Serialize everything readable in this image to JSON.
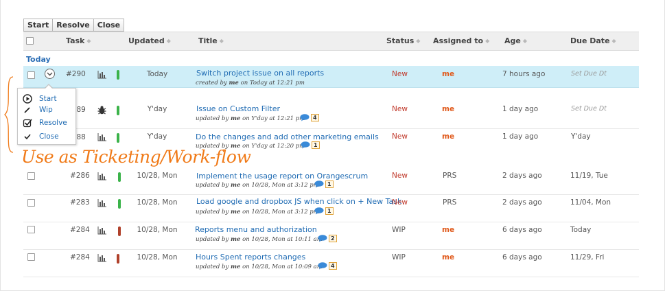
{
  "toolbar": {
    "start": "Start",
    "resolve": "Resolve",
    "close": "Close"
  },
  "columns": {
    "task": "Task",
    "updated": "Updated",
    "title": "Title",
    "status": "Status",
    "assigned": "Assigned to",
    "age": "Age",
    "due": "Due Date"
  },
  "group": "Today",
  "rows": [
    {
      "task": "#290",
      "updated": "Today",
      "title": "Switch project issue on all reports",
      "sub_a": "created by ",
      "sub_user": "me",
      "sub_b": " on Today at 12:21 pm",
      "status": "New",
      "assigned": "me",
      "age": "7 hours ago",
      "due": "Set Due Dt",
      "comments": ""
    },
    {
      "task": "#289",
      "updated": "Y'day",
      "title": "Issue on Custom Filter",
      "sub_a": "updated by ",
      "sub_user": "me",
      "sub_b": " on Y'day at 12:21 pm",
      "status": "New",
      "assigned": "me",
      "age": "1 day ago",
      "due": "Set Due Dt",
      "comments": "4"
    },
    {
      "task": "#288",
      "updated": "Y'day",
      "title": "Do the changes and add other marketing emails",
      "sub_a": "updated by ",
      "sub_user": "me",
      "sub_b": " on Y'day at 12:20 pm",
      "status": "New",
      "assigned": "me",
      "age": "1 day ago",
      "due": "Y'day",
      "comments": "1"
    },
    {
      "task": "#286",
      "updated": "10/28, Mon",
      "title": "Implement the usage report on Orangescrum",
      "sub_a": "updated by ",
      "sub_user": "me",
      "sub_b": " on 10/28, Mon at 3:12 pm",
      "status": "New",
      "assigned": "PRS",
      "age": "2 days ago",
      "due": "11/19, Tue",
      "comments": "1"
    },
    {
      "task": "#283",
      "updated": "10/28, Mon",
      "title": "Load google and dropbox JS when click on + New Task",
      "sub_a": "updated by ",
      "sub_user": "me",
      "sub_b": " on 10/28, Mon at 3:12 pm",
      "status": "New",
      "assigned": "PRS",
      "age": "2 days ago",
      "due": "11/04, Mon",
      "comments": "1"
    },
    {
      "task": "#284",
      "updated": "10/28, Mon",
      "title": "Reports menu and authorization",
      "sub_a": "updated by ",
      "sub_user": "me",
      "sub_b": " on 10/28, Mon at 10:11 am",
      "status": "WIP",
      "assigned": "me",
      "age": "6 days ago",
      "due": "Today",
      "comments": "2"
    },
    {
      "task": "#284",
      "updated": "10/28, Mon",
      "title": "Hours Spent reports changes",
      "sub_a": "updated by ",
      "sub_user": "me",
      "sub_b": " on 10/28, Mon at 10:09 am",
      "status": "WIP",
      "assigned": "me",
      "age": "6 days ago",
      "due": "11/29, Fri",
      "comments": "4"
    }
  ],
  "menu": {
    "start": "Start",
    "wip": "Wip",
    "resolve": "Resolve",
    "close": "Close"
  },
  "annotation": "Use as Ticketing/Work-flow",
  "colors": {
    "priority_green": "#3bb34a",
    "priority_red": "#b0412b",
    "link": "#1f6bb3",
    "highlight_row": "#cfeef8",
    "accent": "#f07a18"
  }
}
